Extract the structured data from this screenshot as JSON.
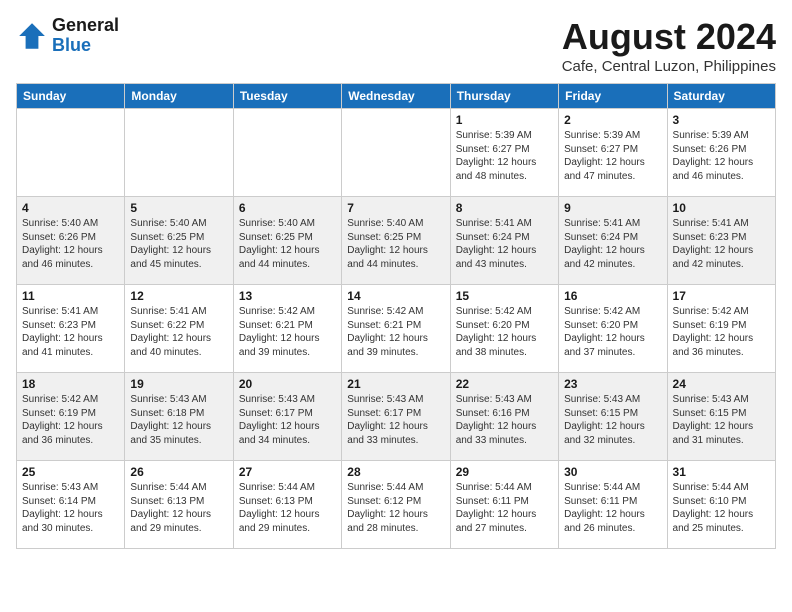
{
  "logo": {
    "general": "General",
    "blue": "Blue"
  },
  "title": "August 2024",
  "location": "Cafe, Central Luzon, Philippines",
  "days_of_week": [
    "Sunday",
    "Monday",
    "Tuesday",
    "Wednesday",
    "Thursday",
    "Friday",
    "Saturday"
  ],
  "weeks": [
    [
      {
        "day": "",
        "sunrise": "",
        "sunset": "",
        "daylight": ""
      },
      {
        "day": "",
        "sunrise": "",
        "sunset": "",
        "daylight": ""
      },
      {
        "day": "",
        "sunrise": "",
        "sunset": "",
        "daylight": ""
      },
      {
        "day": "",
        "sunrise": "",
        "sunset": "",
        "daylight": ""
      },
      {
        "day": "1",
        "sunrise": "Sunrise: 5:39 AM",
        "sunset": "Sunset: 6:27 PM",
        "daylight": "Daylight: 12 hours and 48 minutes."
      },
      {
        "day": "2",
        "sunrise": "Sunrise: 5:39 AM",
        "sunset": "Sunset: 6:27 PM",
        "daylight": "Daylight: 12 hours and 47 minutes."
      },
      {
        "day": "3",
        "sunrise": "Sunrise: 5:39 AM",
        "sunset": "Sunset: 6:26 PM",
        "daylight": "Daylight: 12 hours and 46 minutes."
      }
    ],
    [
      {
        "day": "4",
        "sunrise": "Sunrise: 5:40 AM",
        "sunset": "Sunset: 6:26 PM",
        "daylight": "Daylight: 12 hours and 46 minutes."
      },
      {
        "day": "5",
        "sunrise": "Sunrise: 5:40 AM",
        "sunset": "Sunset: 6:25 PM",
        "daylight": "Daylight: 12 hours and 45 minutes."
      },
      {
        "day": "6",
        "sunrise": "Sunrise: 5:40 AM",
        "sunset": "Sunset: 6:25 PM",
        "daylight": "Daylight: 12 hours and 44 minutes."
      },
      {
        "day": "7",
        "sunrise": "Sunrise: 5:40 AM",
        "sunset": "Sunset: 6:25 PM",
        "daylight": "Daylight: 12 hours and 44 minutes."
      },
      {
        "day": "8",
        "sunrise": "Sunrise: 5:41 AM",
        "sunset": "Sunset: 6:24 PM",
        "daylight": "Daylight: 12 hours and 43 minutes."
      },
      {
        "day": "9",
        "sunrise": "Sunrise: 5:41 AM",
        "sunset": "Sunset: 6:24 PM",
        "daylight": "Daylight: 12 hours and 42 minutes."
      },
      {
        "day": "10",
        "sunrise": "Sunrise: 5:41 AM",
        "sunset": "Sunset: 6:23 PM",
        "daylight": "Daylight: 12 hours and 42 minutes."
      }
    ],
    [
      {
        "day": "11",
        "sunrise": "Sunrise: 5:41 AM",
        "sunset": "Sunset: 6:23 PM",
        "daylight": "Daylight: 12 hours and 41 minutes."
      },
      {
        "day": "12",
        "sunrise": "Sunrise: 5:41 AM",
        "sunset": "Sunset: 6:22 PM",
        "daylight": "Daylight: 12 hours and 40 minutes."
      },
      {
        "day": "13",
        "sunrise": "Sunrise: 5:42 AM",
        "sunset": "Sunset: 6:21 PM",
        "daylight": "Daylight: 12 hours and 39 minutes."
      },
      {
        "day": "14",
        "sunrise": "Sunrise: 5:42 AM",
        "sunset": "Sunset: 6:21 PM",
        "daylight": "Daylight: 12 hours and 39 minutes."
      },
      {
        "day": "15",
        "sunrise": "Sunrise: 5:42 AM",
        "sunset": "Sunset: 6:20 PM",
        "daylight": "Daylight: 12 hours and 38 minutes."
      },
      {
        "day": "16",
        "sunrise": "Sunrise: 5:42 AM",
        "sunset": "Sunset: 6:20 PM",
        "daylight": "Daylight: 12 hours and 37 minutes."
      },
      {
        "day": "17",
        "sunrise": "Sunrise: 5:42 AM",
        "sunset": "Sunset: 6:19 PM",
        "daylight": "Daylight: 12 hours and 36 minutes."
      }
    ],
    [
      {
        "day": "18",
        "sunrise": "Sunrise: 5:42 AM",
        "sunset": "Sunset: 6:19 PM",
        "daylight": "Daylight: 12 hours and 36 minutes."
      },
      {
        "day": "19",
        "sunrise": "Sunrise: 5:43 AM",
        "sunset": "Sunset: 6:18 PM",
        "daylight": "Daylight: 12 hours and 35 minutes."
      },
      {
        "day": "20",
        "sunrise": "Sunrise: 5:43 AM",
        "sunset": "Sunset: 6:17 PM",
        "daylight": "Daylight: 12 hours and 34 minutes."
      },
      {
        "day": "21",
        "sunrise": "Sunrise: 5:43 AM",
        "sunset": "Sunset: 6:17 PM",
        "daylight": "Daylight: 12 hours and 33 minutes."
      },
      {
        "day": "22",
        "sunrise": "Sunrise: 5:43 AM",
        "sunset": "Sunset: 6:16 PM",
        "daylight": "Daylight: 12 hours and 33 minutes."
      },
      {
        "day": "23",
        "sunrise": "Sunrise: 5:43 AM",
        "sunset": "Sunset: 6:15 PM",
        "daylight": "Daylight: 12 hours and 32 minutes."
      },
      {
        "day": "24",
        "sunrise": "Sunrise: 5:43 AM",
        "sunset": "Sunset: 6:15 PM",
        "daylight": "Daylight: 12 hours and 31 minutes."
      }
    ],
    [
      {
        "day": "25",
        "sunrise": "Sunrise: 5:43 AM",
        "sunset": "Sunset: 6:14 PM",
        "daylight": "Daylight: 12 hours and 30 minutes."
      },
      {
        "day": "26",
        "sunrise": "Sunrise: 5:44 AM",
        "sunset": "Sunset: 6:13 PM",
        "daylight": "Daylight: 12 hours and 29 minutes."
      },
      {
        "day": "27",
        "sunrise": "Sunrise: 5:44 AM",
        "sunset": "Sunset: 6:13 PM",
        "daylight": "Daylight: 12 hours and 29 minutes."
      },
      {
        "day": "28",
        "sunrise": "Sunrise: 5:44 AM",
        "sunset": "Sunset: 6:12 PM",
        "daylight": "Daylight: 12 hours and 28 minutes."
      },
      {
        "day": "29",
        "sunrise": "Sunrise: 5:44 AM",
        "sunset": "Sunset: 6:11 PM",
        "daylight": "Daylight: 12 hours and 27 minutes."
      },
      {
        "day": "30",
        "sunrise": "Sunrise: 5:44 AM",
        "sunset": "Sunset: 6:11 PM",
        "daylight": "Daylight: 12 hours and 26 minutes."
      },
      {
        "day": "31",
        "sunrise": "Sunrise: 5:44 AM",
        "sunset": "Sunset: 6:10 PM",
        "daylight": "Daylight: 12 hours and 25 minutes."
      }
    ]
  ]
}
